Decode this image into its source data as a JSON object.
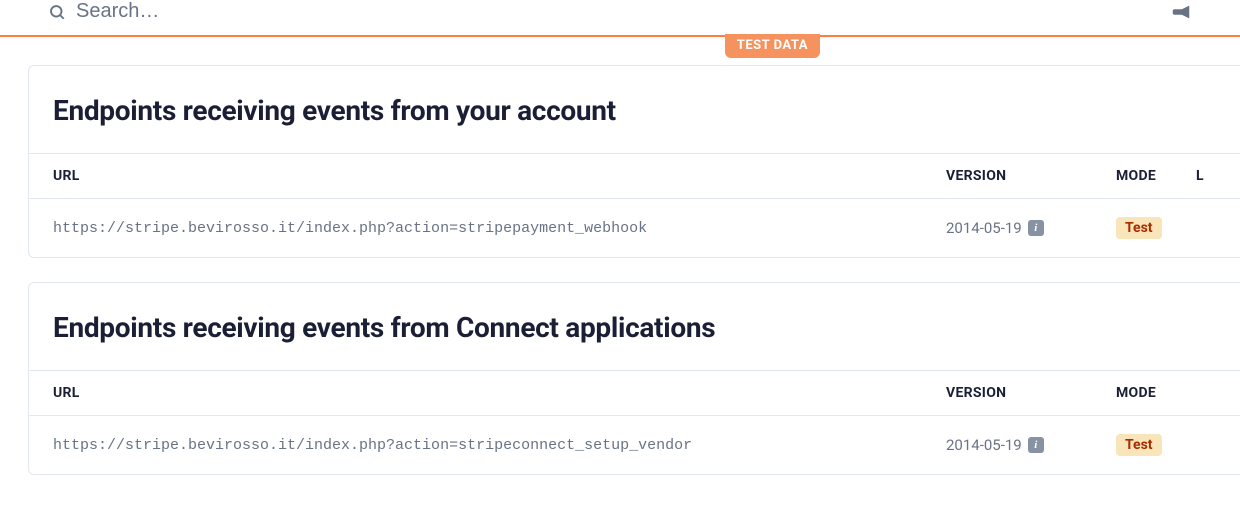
{
  "search": {
    "placeholder": "Search…"
  },
  "test_data_badge": "TEST DATA",
  "columns": {
    "url": "URL",
    "version": "VERSION",
    "mode": "MODE",
    "last": "L"
  },
  "sections": [
    {
      "title": "Endpoints receiving events from your account",
      "rows": [
        {
          "url": "https://stripe.bevirosso.it/index.php?action=stripepayment_webhook",
          "version": "2014-05-19",
          "mode": "Test"
        }
      ]
    },
    {
      "title": "Endpoints receiving events from Connect applications",
      "rows": [
        {
          "url": "https://stripe.bevirosso.it/index.php?action=stripeconnect_setup_vendor",
          "version": "2014-05-19",
          "mode": "Test"
        }
      ]
    }
  ]
}
